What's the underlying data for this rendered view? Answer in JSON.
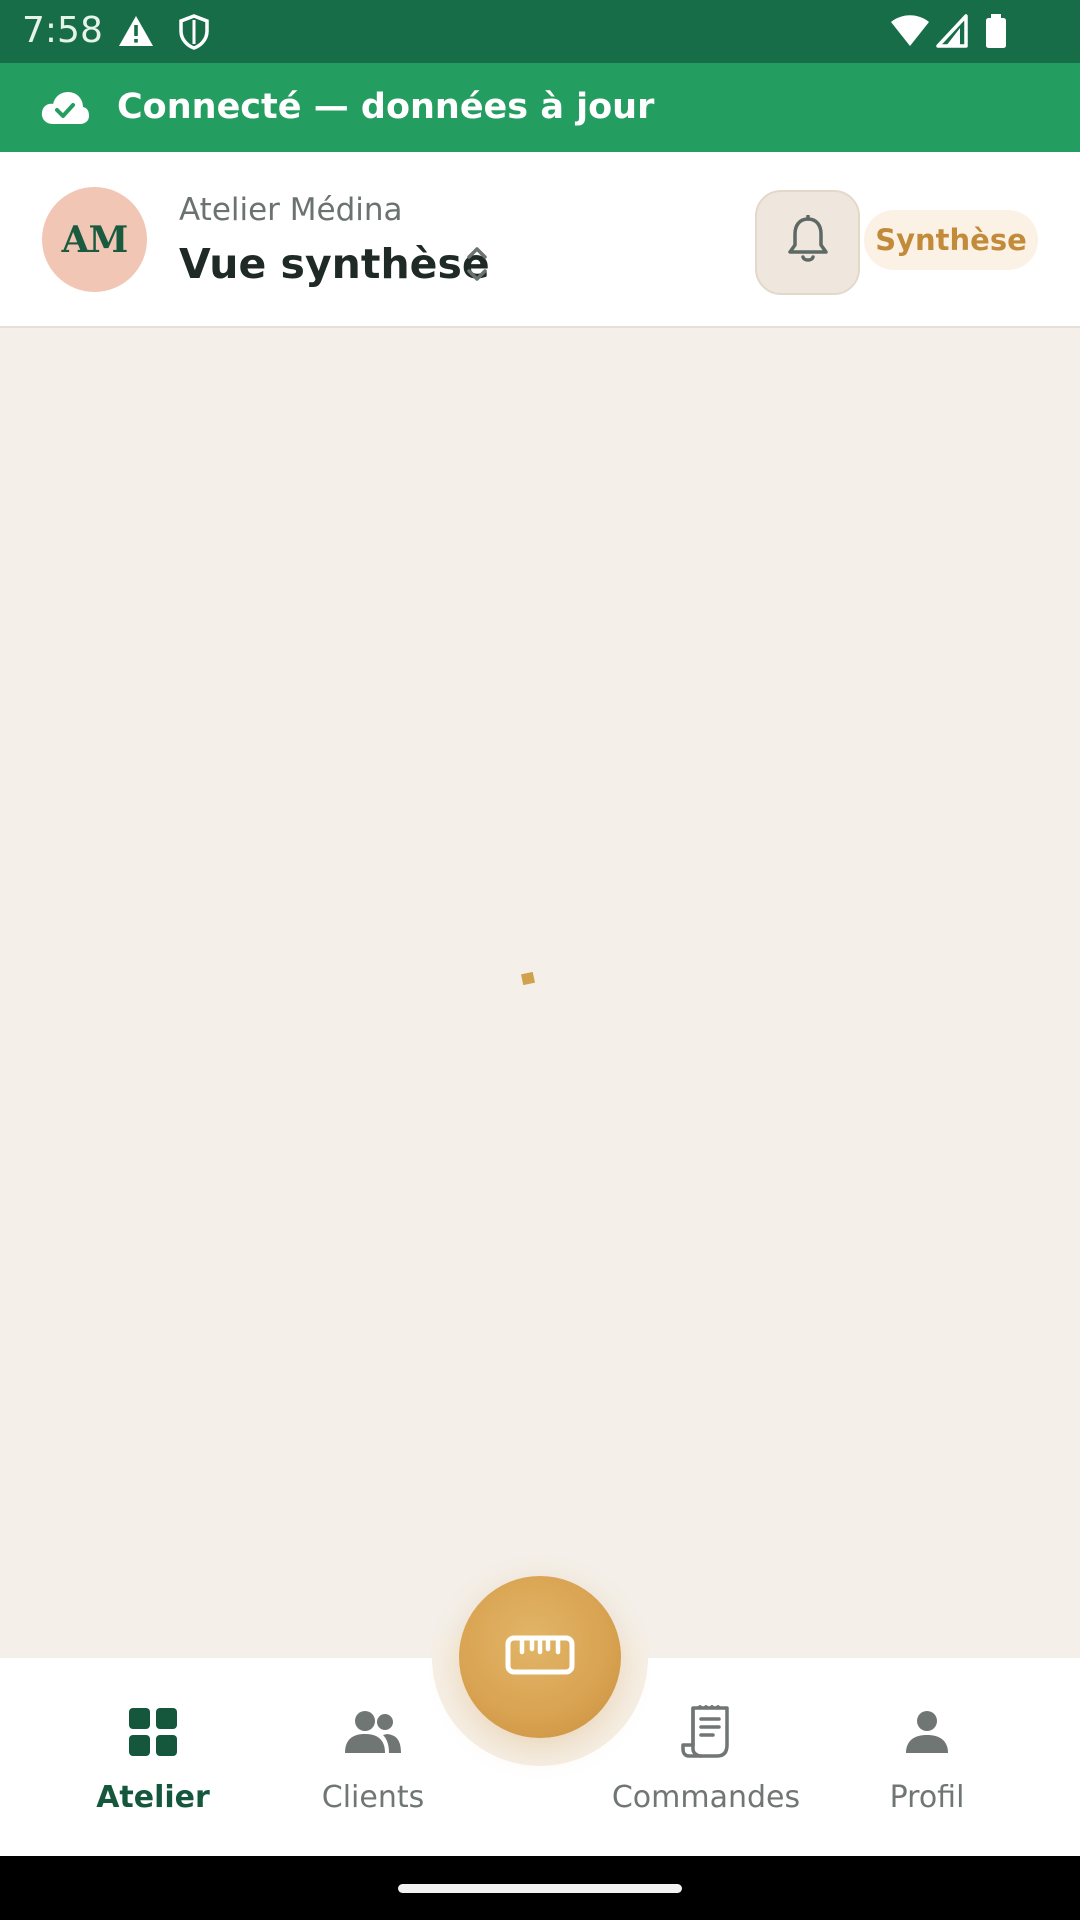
{
  "status_bar": {
    "time": "7:58",
    "icons": [
      "warning-icon",
      "shield-icon",
      "wifi-icon",
      "signal-icon",
      "battery-icon"
    ]
  },
  "connection_banner": {
    "text": "Connecté — données à jour",
    "icon": "cloud-check-icon",
    "color": "#239e60"
  },
  "header": {
    "avatar_initials": "AM",
    "workshop_name": "Atelier Médina",
    "view_title": "Vue synthèse",
    "mode_badge": "Synthèse",
    "notification_icon": "bell-icon"
  },
  "fab": {
    "icon": "ruler-icon",
    "color": "#d9a453"
  },
  "bottom_nav": {
    "items": [
      {
        "label": "Atelier",
        "icon": "grid-icon",
        "active": true
      },
      {
        "label": "Clients",
        "icon": "people-icon",
        "active": false
      },
      {
        "label": "Commandes",
        "icon": "receipt-icon",
        "active": false
      },
      {
        "label": "Profil",
        "icon": "person-icon",
        "active": false
      }
    ]
  },
  "colors": {
    "primary_dark": "#176d47",
    "accent_gold": "#c28b3a",
    "background": "#f4efe8"
  }
}
